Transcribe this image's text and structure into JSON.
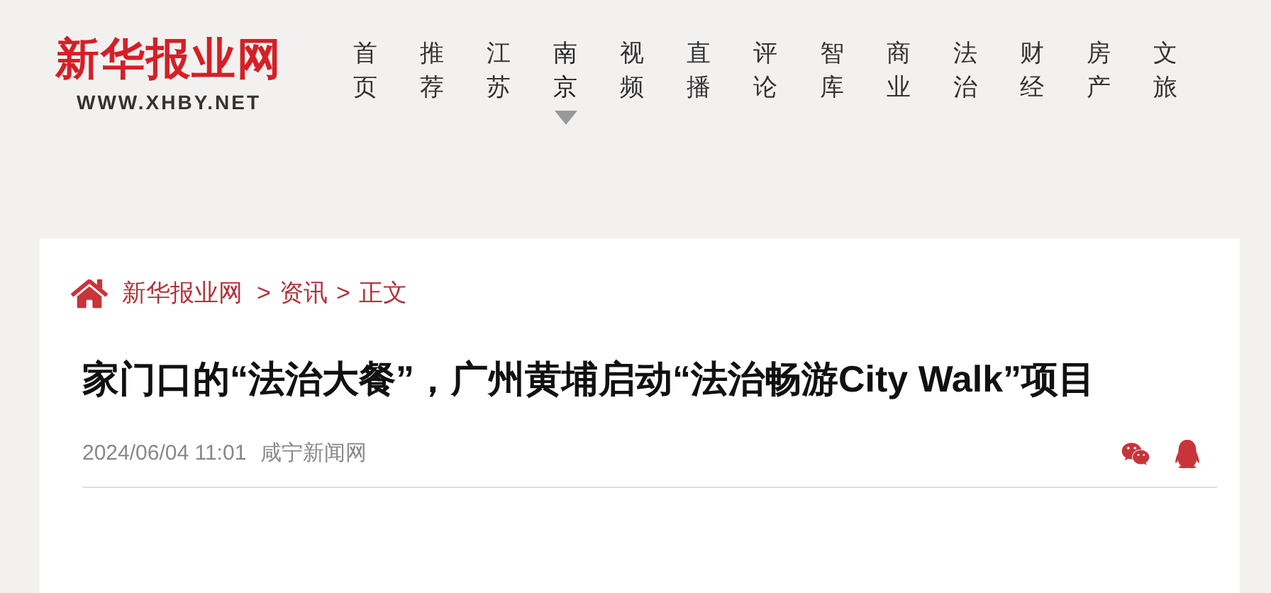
{
  "logo": {
    "name": "新华报业网",
    "url": "WWW.XHBY.NET"
  },
  "nav": [
    {
      "label": "首页",
      "selected": false
    },
    {
      "label": "推荐",
      "selected": false
    },
    {
      "label": "江苏",
      "selected": false
    },
    {
      "label": "南京",
      "selected": true
    },
    {
      "label": "视频",
      "selected": false
    },
    {
      "label": "直播",
      "selected": false
    },
    {
      "label": "评论",
      "selected": false
    },
    {
      "label": "智库",
      "selected": false
    },
    {
      "label": "商业",
      "selected": false
    },
    {
      "label": "法治",
      "selected": false
    },
    {
      "label": "财经",
      "selected": false
    },
    {
      "label": "房产",
      "selected": false
    },
    {
      "label": "文旅",
      "selected": false
    }
  ],
  "breadcrumb": {
    "separator": ">",
    "items": [
      "新华报业网",
      "资讯",
      "正文"
    ]
  },
  "article": {
    "title": "家门口的“法治大餐”，广州黄埔启动“法治畅游City Walk”项目",
    "date": "2024/06/04 11:01",
    "source": "咸宁新闻网"
  }
}
